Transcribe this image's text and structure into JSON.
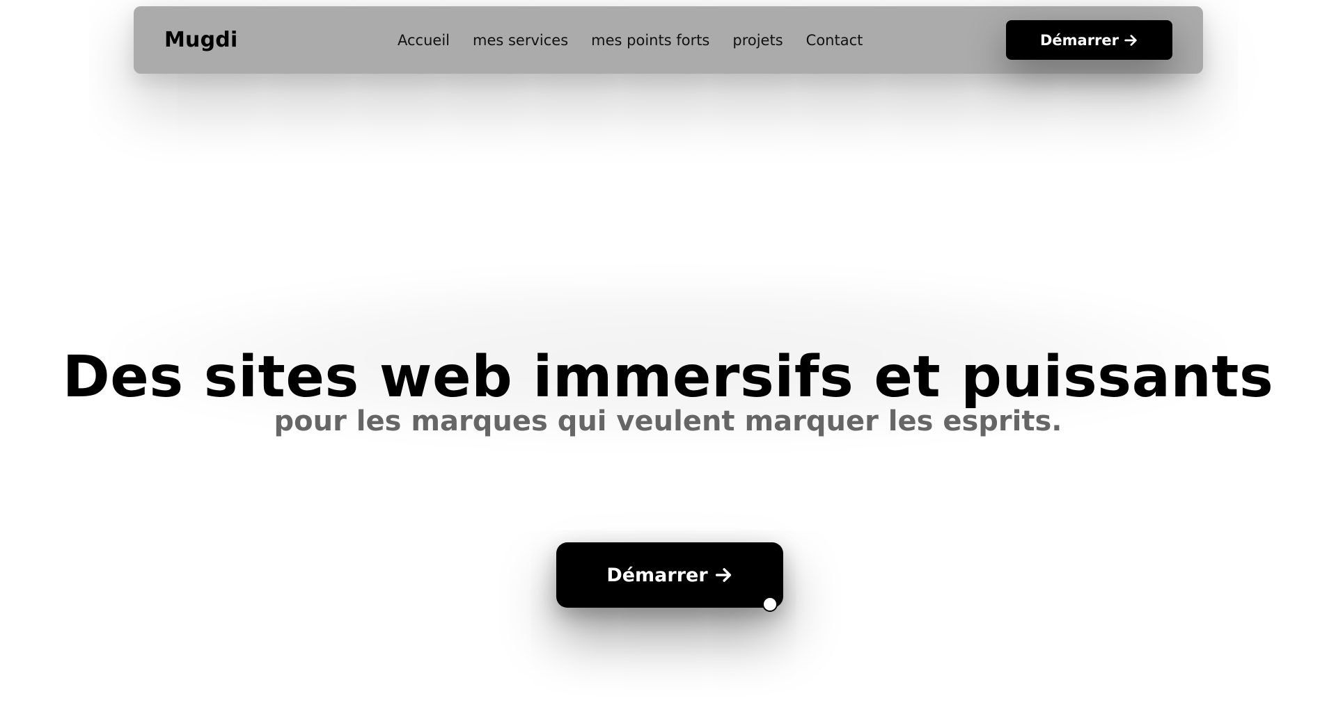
{
  "navbar": {
    "brand": "Mugdi",
    "links": [
      {
        "label": "Accueil"
      },
      {
        "label": "mes services"
      },
      {
        "label": "mes points forts"
      },
      {
        "label": "projets"
      },
      {
        "label": "Contact"
      }
    ],
    "cta_label": "Démarrer",
    "cta_icon": "arrow-right-icon"
  },
  "hero": {
    "title": "Des sites web immersifs et puissants",
    "subtitle": "pour les marques qui veulent marquer les esprits.",
    "cta_label": "Démarrer",
    "cta_icon": "arrow-right-icon"
  },
  "colors": {
    "navbar_bg": "#ababab",
    "button_bg": "#000000",
    "button_text": "#ffffff",
    "subtitle_text": "#666666",
    "page_bg": "#ffffff"
  }
}
